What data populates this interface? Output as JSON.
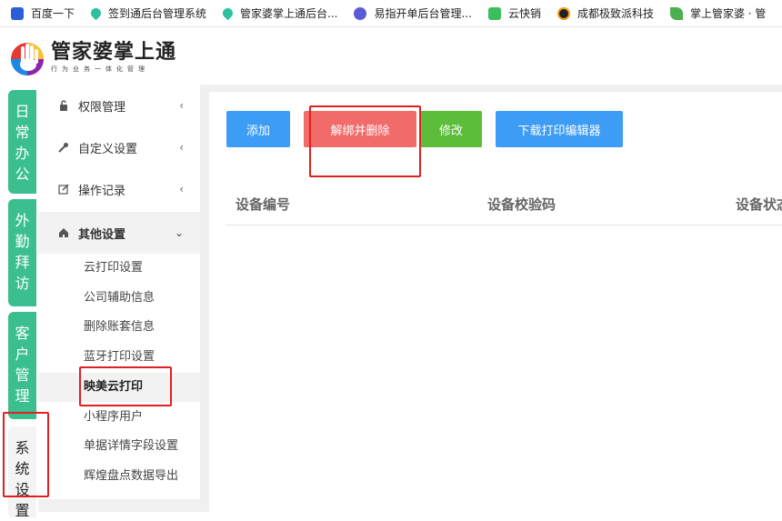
{
  "bookmarks": [
    {
      "label": "百度一下",
      "icon": "baidu-paw-icon",
      "color": "#2b5fd9"
    },
    {
      "label": "签到通后台管理系统",
      "icon": "location-pin-icon",
      "color": "#2cc0a0"
    },
    {
      "label": "管家婆掌上通后台...",
      "icon": "location-pin-icon",
      "color": "#2cc0a0"
    },
    {
      "label": "易指开单后台管理...",
      "icon": "globe-icon",
      "color": "#5b5bd6"
    },
    {
      "label": "云快销",
      "icon": "yunkuaixiao-icon",
      "color": "#3bbf5b"
    },
    {
      "label": "成都极致派科技",
      "icon": "jizhipai-icon",
      "color": "#222222"
    },
    {
      "label": "掌上管家婆 · 管",
      "icon": "leaf-icon",
      "color": "#4caf50"
    }
  ],
  "logo": {
    "title": "管家婆掌上通",
    "subtitle": "行为业务一体化管理"
  },
  "vtabs": [
    {
      "label": "日\n常\n办\n公"
    },
    {
      "label": "外\n勤\n拜\n访"
    },
    {
      "label": "客\n户\n管\n理"
    },
    {
      "label": "系\n统\n设\n置"
    }
  ],
  "sidebar": {
    "items": [
      {
        "label": "权限管理",
        "icon": "lock-icon"
      },
      {
        "label": "自定义设置",
        "icon": "wrench-icon"
      },
      {
        "label": "操作记录",
        "icon": "edit-icon"
      },
      {
        "label": "其他设置",
        "icon": "home-icon"
      }
    ],
    "subitems": [
      {
        "label": "云打印设置"
      },
      {
        "label": "公司辅助信息"
      },
      {
        "label": "删除账套信息"
      },
      {
        "label": "蓝牙打印设置"
      },
      {
        "label": "映美云打印"
      },
      {
        "label": "小程序用户"
      },
      {
        "label": "单据详情字段设置"
      },
      {
        "label": "辉煌盘点数据导出"
      }
    ]
  },
  "toolbar": {
    "add_label": "添加",
    "unbind_label": "解绑并删除",
    "edit_label": "修改",
    "download_label": "下载打印编辑器"
  },
  "table": {
    "columns": [
      "设备编号",
      "设备校验码",
      "设备状态"
    ]
  },
  "colors": {
    "green_tab": "#3bbf8f",
    "blue_button": "#3d9df5",
    "red_button": "#f26b6b",
    "green_button": "#5cbd3a",
    "annotation_red": "#e02020"
  }
}
